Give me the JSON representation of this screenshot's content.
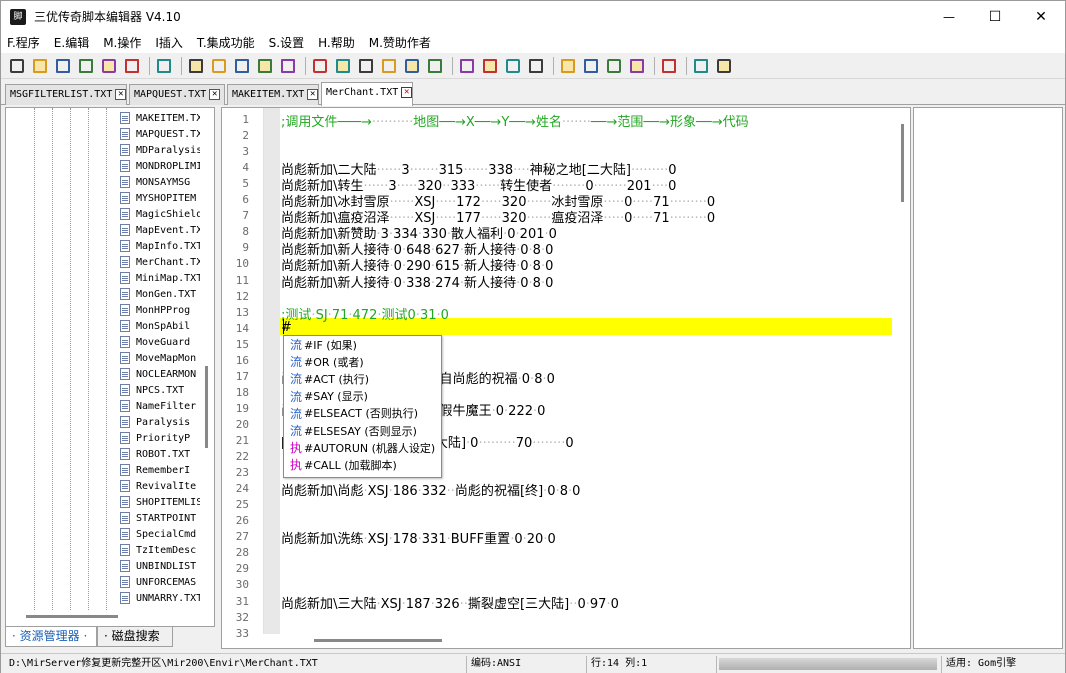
{
  "window": {
    "title": "三优传奇脚本编辑器 V4.10",
    "minimize_glyph": "—",
    "maximize_glyph": "☐",
    "close_glyph": "✕"
  },
  "menu": [
    "F.程序",
    "E.编辑",
    "M.操作",
    "I插入",
    "T.集成功能",
    "S.设置",
    "H.帮助",
    "M.赞助作者"
  ],
  "toolbar": {
    "icons": [
      "new-file-icon",
      "open-file-icon",
      "save-icon",
      "save-all-icon",
      "file-props-icon",
      "copy-file-icon",
      "align-icon",
      "cut-icon",
      "copy-icon",
      "paste-icon",
      "undo-icon",
      "redo-icon",
      "insert-row-icon",
      "insert-col-icon",
      "indent-icon",
      "format-icon",
      "preview-icon",
      "find-icon",
      "navigate-back-icon",
      "color-grid-icon",
      "comment-icon",
      "uncomment-icon",
      "list-icon",
      "split-h-icon",
      "layout-left-icon",
      "layout-right-icon",
      "settings-icon",
      "book-icon",
      "globe-search-icon"
    ]
  },
  "tabs": [
    {
      "label": "MSGFILTERLIST.TXT",
      "active": false
    },
    {
      "label": "MAPQUEST.TXT",
      "active": false
    },
    {
      "label": "MAKEITEM.TXT",
      "active": false
    },
    {
      "label": "MerChant.TXT",
      "active": true
    }
  ],
  "tab_close_glyph": "✕",
  "file_tree": [
    "MAKEITEM.TXT",
    "MAPQUEST.TXT",
    "MDParalysis",
    "MONDROPLIMIT",
    "MONSAYMSG",
    "MYSHOPITEM",
    "MagicShield",
    "MapEvent.TXT",
    "MapInfo.TXT",
    "MerChant.TXT",
    "MiniMap.TXT",
    "MonGen.TXT",
    "MonHPProg",
    "MonSpAbil",
    "MoveGuard",
    "MoveMapMon",
    "NOCLEARMON",
    "NPCS.TXT",
    "NameFilter",
    "Paralysis",
    "PriorityP",
    "ROBOT.TXT",
    "RememberI",
    "RevivalIte",
    "SHOPITEMLIST",
    "STARTPOINT",
    "SpecialCmd",
    "TzItemDesc",
    "UNBINDLIST",
    "UNFORCEMAS",
    "UNMARRY.TXT"
  ],
  "left_tabs": [
    "· 资源管理器 ·",
    "· 磁盘搜索 ·"
  ],
  "editor": {
    "current_line": 14,
    "lines": [
      {
        "n": 1,
        "text": ";调用文件───→··········地图──→X──→Y──→姓名·······──→范围──→形象──→代码",
        "green": true
      },
      {
        "n": 2,
        "text": ""
      },
      {
        "n": 3,
        "text": ""
      },
      {
        "n": 4,
        "text": "尚彪新加\\二大陆······3·······315······338····神秘之地[二大陆]·········0"
      },
      {
        "n": 5,
        "text": "尚彪新加\\转生······3·····320··333······转生使者········0········201····0"
      },
      {
        "n": 6,
        "text": "尚彪新加\\冰封雪原······XSJ·····172·····320······冰封雪原·····0·····71·········0"
      },
      {
        "n": 7,
        "text": "尚彪新加\\瘟疫沼泽······XSJ·····177·····320······瘟疫沼泽·····0·····71·········0"
      },
      {
        "n": 8,
        "text": "尚彪新加\\新赞助·3·334·330·散人福利·0·201·0"
      },
      {
        "n": 9,
        "text": "尚彪新加\\新人接待·0·648·627·新人接待·0·8·0"
      },
      {
        "n": 10,
        "text": "尚彪新加\\新人接待·0·290·615·新人接待·0·8·0"
      },
      {
        "n": 11,
        "text": "尚彪新加\\新人接待·0·338·274·新人接待·0·8·0"
      },
      {
        "n": 12,
        "text": ""
      },
      {
        "n": 13,
        "text": ";测试·SJ·71·472·测试0·31·0",
        "green": true
      },
      {
        "n": 14,
        "text": "#"
      },
      {
        "n": 15,
        "text": ""
      },
      {
        "n": 16,
        "text": ""
      },
      {
        "n": 17,
        "text": "尚··············3·337·334··来自尚彪的祝福·0·8·0"
      },
      {
        "n": 18,
        "text": ""
      },
      {
        "n": 19,
        "text": "尚··············3·331·326··真假牛魔王·0·222·0"
      },
      {
        "n": 20,
        "text": ""
      },
      {
        "n": 21,
        "text": "[··············39·进入神界[四大陆]·0·········70········0"
      },
      {
        "n": 22,
        "text": ""
      },
      {
        "n": 23,
        "text": ""
      },
      {
        "n": 24,
        "text": "尚彪新加\\尚彪·XSJ·186·332··尚彪的祝福[终]·0·8·0"
      },
      {
        "n": 25,
        "text": ""
      },
      {
        "n": 26,
        "text": ""
      },
      {
        "n": 27,
        "text": "尚彪新加\\洗练·XSJ·178·331·BUFF重置·0·20·0"
      },
      {
        "n": 28,
        "text": ""
      },
      {
        "n": 29,
        "text": ""
      },
      {
        "n": 30,
        "text": ""
      },
      {
        "n": 31,
        "text": "尚彪新加\\三大陆·XSJ·187·326··撕裂虚空[三大陆]··0·97·0"
      },
      {
        "n": 32,
        "text": ""
      },
      {
        "n": 33,
        "text": ""
      }
    ]
  },
  "autocomplete": [
    {
      "kind": "流",
      "type": "flow",
      "label": "#IF (如果)"
    },
    {
      "kind": "流",
      "type": "flow",
      "label": "#OR (或者)"
    },
    {
      "kind": "流",
      "type": "flow",
      "label": "#ACT (执行)"
    },
    {
      "kind": "流",
      "type": "flow",
      "label": "#SAY (显示)"
    },
    {
      "kind": "流",
      "type": "flow",
      "label": "#ELSEACT (否则执行)"
    },
    {
      "kind": "流",
      "type": "flow",
      "label": "#ELSESAY (否则显示)"
    },
    {
      "kind": "执",
      "type": "exec",
      "label": "#AUTORUN (机器人设定)"
    },
    {
      "kind": "执",
      "type": "exec",
      "label": "#CALL (加载脚本)"
    }
  ],
  "status": {
    "path": "D:\\MirServer修复更新完整开区\\Mir200\\Envir\\MerChant.TXT",
    "encoding": "编码:ANSI",
    "position": "行:14  列:1",
    "engine": "适用: Gom引擎"
  },
  "colors": {
    "comment": "#22a722",
    "current_line": "#ffff00",
    "flow_kind": "#2a64c8",
    "exec_kind": "#d000c8"
  }
}
